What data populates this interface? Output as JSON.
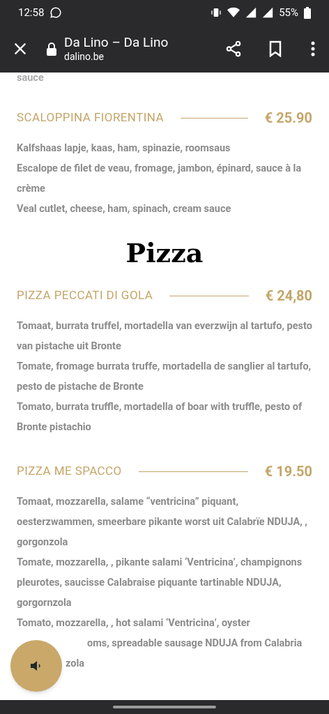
{
  "status_bar": {
    "time": "12:58",
    "battery": "55%"
  },
  "toolbar": {
    "title": "Da Lino – Da Lino",
    "url": "dalino.be"
  },
  "top_fragment": "sauce",
  "items": [
    {
      "kind": "dish",
      "name": "SCALOPPINA FIORENTINA",
      "price": "€ 25.90",
      "descriptions": [
        "Kalfshaas lapje, kaas, ham, spinazie, roomsaus",
        "Escalope de filet de veau, fromage, jambon, épinard, sauce à la crème",
        "Veal cutlet, cheese, ham, spinach, cream sauce"
      ]
    },
    {
      "kind": "section",
      "title": "Pizza"
    },
    {
      "kind": "dish",
      "name": "PIZZA PECCATI DI GOLA",
      "price": "€ 24,80",
      "descriptions": [
        "Tomaat, burrata truffel, mortadella van everzwijn al tartufo, pesto van pistache uit Bronte",
        "Tomate, fromage burrata truffe, mortadella de sanglier al tartufo, pesto de pistache de Bronte",
        "Tomato, burrata truffle, mortadella of boar with truffle, pesto of Bronte pistachio"
      ]
    },
    {
      "kind": "dish",
      "name": "PIZZA ME SPACCO",
      "price": "€ 19.50",
      "descriptions": [
        "Tomaat, mozzarella, salame “ventricina” piquant, oesterzwammen, smeerbare pikante worst uit Calabrïe NDUJA, , gorgonzola",
        "Tomate, mozzarella, , pikante salami ‘Ventricina’, champignons pleurotes, saucisse Calabraise piquante tartinable NDUJA, gorgornzola",
        "Tomato, mozzarella, , hot salami ‘Ventricina’, oyster"
      ],
      "obscured_lines": [
        "oms, spreadable sausage NDUJA from Calabria",
        "zola"
      ]
    }
  ]
}
